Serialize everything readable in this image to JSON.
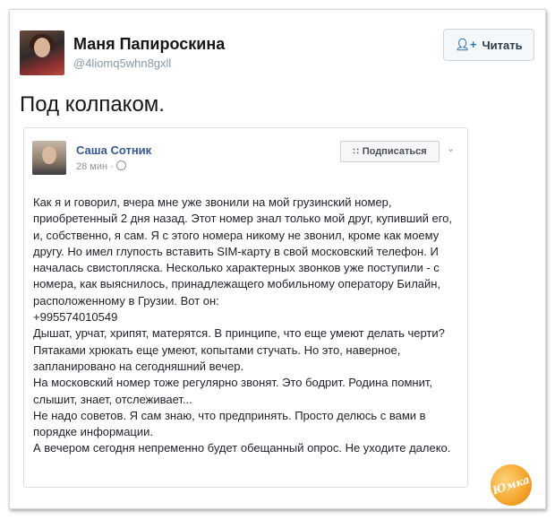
{
  "tweet": {
    "author_name": "Маня Папироскина",
    "author_handle": "@4liomq5whn8gxll",
    "follow_label": "Читать",
    "text": "Под колпаком."
  },
  "fb_post": {
    "author_name": "Саша Сотник",
    "time": "28 мин ·",
    "follow_label": "Подписаться",
    "body": "Как я и говорил, вчера мне уже звонили на мой грузинский номер, приобретенный 2 дня назад. Этот номер знал только мой друг, купивший его, и, собственно, я сам. Я с этого номера никому не звонил, кроме как моему другу. Но имел глупость вставить SIM-карту в свой московский телефон. И началась свистопляска. Несколько характерных звонков уже поступили - с номера, как выяснилось, принадлежащего мобильному оператору Билайн, расположенному в Грузии. Вот он:\n+995574010549\nДышат, урчат, хрипят, матерятся. В принципе, что еще умеют делать черти? Пятаками хрюкать еще умеют, копытами стучать. Но это, наверное, запланировано на сегодняшний вечер.\nНа московский номер тоже регулярно звонят. Это бодрит. Родина помнит, слышит, знает, отслеживает...\nНе надо советов. Я сам знаю, что предпринять. Просто делюсь с вами в порядке информации.\nА вечером сегодня непременно будет обещанный опрос. Не уходите далеко."
  },
  "watermark": "Юмка",
  "icons": {
    "follow": "add-user-icon",
    "fb_follow": "rss-icon",
    "menu": "chevron-down-icon",
    "privacy": "globe-icon"
  },
  "colors": {
    "fb_link": "#365899",
    "twitter_blue": "#2b7bb9",
    "logo_orange": "#f4a52a"
  }
}
